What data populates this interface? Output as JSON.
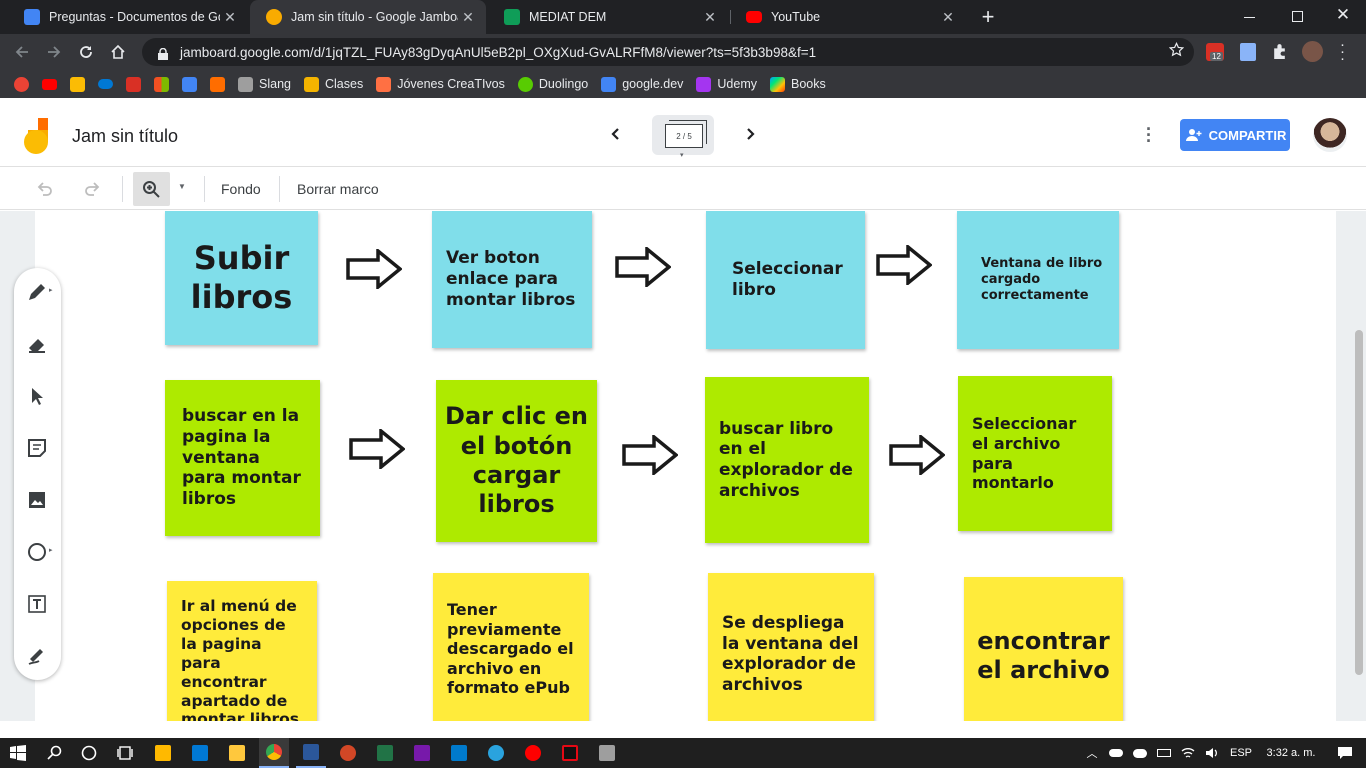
{
  "browser": {
    "tabs": [
      {
        "title": "Preguntas - Documentos de Goo",
        "icon": "google-docs-icon",
        "color": "#4285f4",
        "active": false
      },
      {
        "title": "Jam sin título - Google Jamboard",
        "icon": "jamboard-icon",
        "color": "#f9ab00",
        "active": true
      },
      {
        "title": "MEDIAT DEM",
        "icon": "google-sheets-icon",
        "color": "#0f9d58",
        "active": false
      },
      {
        "title": "YouTube",
        "icon": "youtube-icon",
        "color": "#ff0000",
        "active": false
      }
    ],
    "close_glyph": "✕",
    "new_tab_glyph": "+",
    "url": "jamboard.google.com/d/1jqTZL_FUAy83gDyqAnUl5eB2pl_OXgXud-GvALRFfM8/viewer?ts=5f3b3b98&f=1",
    "extension_badge": "12",
    "bookmarks": [
      {
        "label": "",
        "icon": "google-icon",
        "color": "#ea4335"
      },
      {
        "label": "",
        "icon": "youtube-icon",
        "color": "#ff0000"
      },
      {
        "label": "",
        "icon": "google-drive-icon",
        "color": "#fbbc04"
      },
      {
        "label": "",
        "icon": "onedrive-icon",
        "color": "#0078d4"
      },
      {
        "label": "",
        "icon": "gmail-icon",
        "color": "#d93025"
      },
      {
        "label": "",
        "icon": "microsoft-icon",
        "color": "#7fba00"
      },
      {
        "label": "",
        "icon": "google-translate-icon",
        "color": "#4285f4"
      },
      {
        "label": "",
        "icon": "w-icon",
        "color": "#ff6d00"
      },
      {
        "label": "Slang",
        "icon": "bookmark-icon",
        "color": "#9e9e9e"
      },
      {
        "label": "Clases",
        "icon": "classroom-icon",
        "color": "#f4b400"
      },
      {
        "label": "Jóvenes CreaTIvos",
        "icon": "bookmark-icon",
        "color": "#ff7043"
      },
      {
        "label": "Duolingo",
        "icon": "duolingo-icon",
        "color": "#58cc02"
      },
      {
        "label": "google.dev",
        "icon": "google-dev-icon",
        "color": "#4285f4"
      },
      {
        "label": "Udemy",
        "icon": "udemy-icon",
        "color": "#a435f0"
      },
      {
        "label": "Books",
        "icon": "google-play-icon",
        "color": "#00a0ff"
      }
    ]
  },
  "app": {
    "title": "Jam sin título",
    "frame_indicator": "2 / 5",
    "share_label": "COMPARTIR",
    "toolbar": {
      "background_label": "Fondo",
      "clear_label": "Borrar marco"
    },
    "side_tools": [
      "pen-icon",
      "eraser-icon",
      "select-icon",
      "sticky-note-icon",
      "image-icon",
      "circle-icon",
      "text-box-icon",
      "laser-icon"
    ]
  },
  "notes": {
    "row1": [
      {
        "text": "Subir libros",
        "color": "blue"
      },
      {
        "text": "Ver boton enlace para montar libros",
        "color": "blue"
      },
      {
        "text": "Seleccionar libro",
        "color": "blue"
      },
      {
        "text": "Ventana de libro cargado correctamente",
        "color": "blue"
      }
    ],
    "row2": [
      {
        "text": "buscar en la pagina la ventana para montar libros",
        "color": "green"
      },
      {
        "text": "Dar clic en el botón cargar libros",
        "color": "green"
      },
      {
        "text": "buscar libro en el explorador de archivos",
        "color": "green"
      },
      {
        "text": "Seleccionar el archivo para montarlo",
        "color": "green"
      }
    ],
    "row3": [
      {
        "text": "Ir al menú de opciones de la pagina para encontrar apartado de montar libros",
        "color": "yellow"
      },
      {
        "text": "Tener previamente descargado el archivo en formato ePub",
        "color": "yellow"
      },
      {
        "text": "Se despliega la ventana del explorador de archivos",
        "color": "yellow"
      },
      {
        "text": "encontrar el archivo",
        "color": "yellow"
      }
    ]
  },
  "colors": {
    "blue": "#80deea",
    "green": "#aeea00",
    "yellow": "#ffeb3b",
    "share": "#4285f4"
  },
  "taskbar": {
    "language": "ESP",
    "time": "3:32 a. m."
  }
}
